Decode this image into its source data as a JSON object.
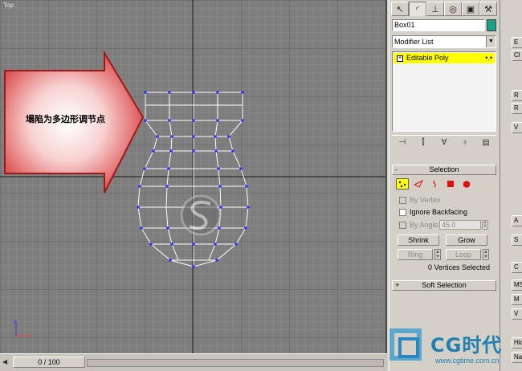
{
  "viewport": {
    "label": "Top",
    "annotation": "塌陷为多边形调节点"
  },
  "timeline": {
    "frame_label": "0 / 100"
  },
  "command_panel": {
    "object_name": "Box01",
    "object_color": "#1aa189",
    "modifier_list": "Modifier List",
    "stack_item": "Editable Poly",
    "selection_rollout": {
      "title": "Selection",
      "by_vertex": "By Vertex",
      "ignore_backfacing": "Ignore Backfacing",
      "by_angle": "By Angle:",
      "angle_value": "45.0",
      "shrink": "Shrink",
      "grow": "Grow",
      "ring": "Ring",
      "loop": "Loop",
      "status": "0 Vertices Selected"
    },
    "soft_selection_title": "Soft Selection"
  },
  "right_strip": {
    "items": [
      "E",
      "Cl",
      "R",
      "R",
      "V",
      "A",
      "S",
      "C",
      "MS",
      "M",
      "V",
      "Hid",
      "Na"
    ]
  },
  "logo": {
    "text": "CG时代",
    "url": "www.cgtime.com.cn"
  }
}
